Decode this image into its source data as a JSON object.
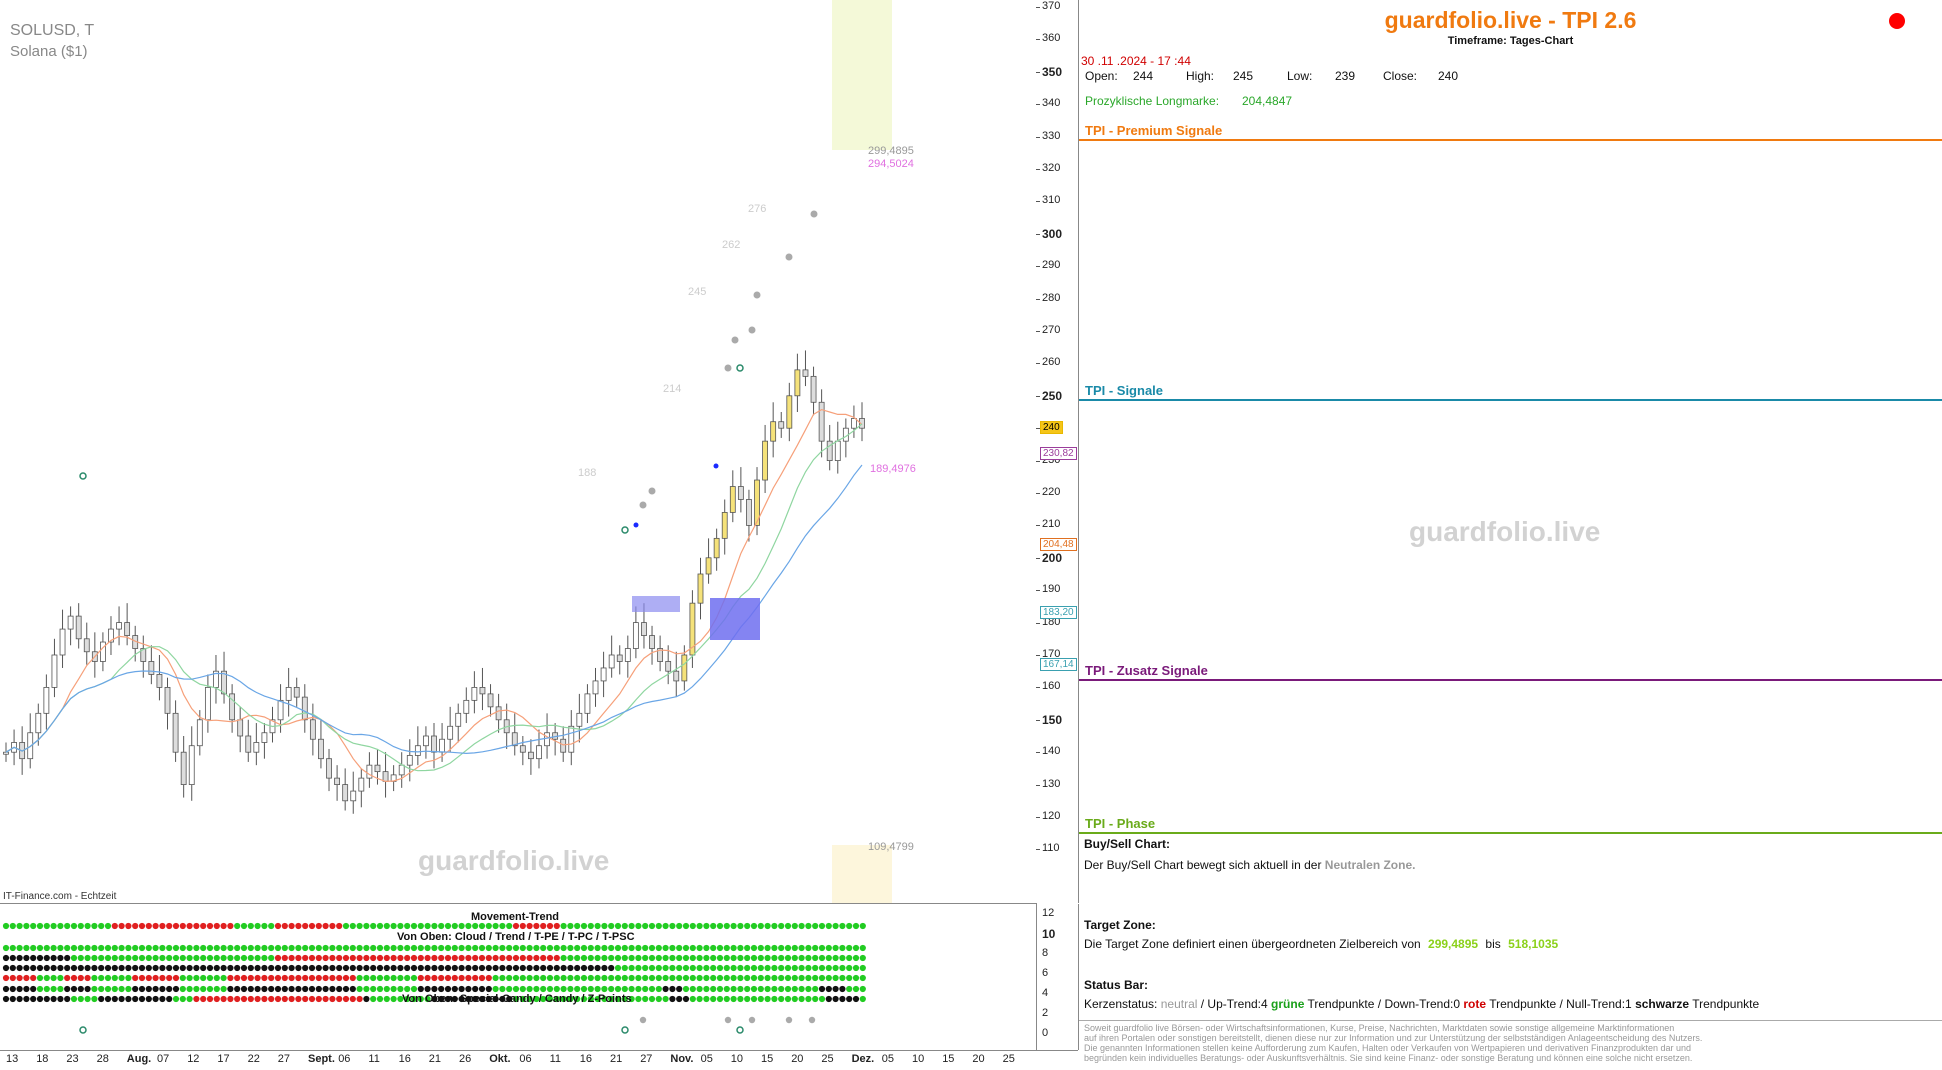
{
  "instrument": {
    "symbol": "SOLUSD, T",
    "name": "Solana ($1)"
  },
  "source_label": "IT-Finance.com - Echtzeit",
  "watermark": "guardfolio.live",
  "chart_data": {
    "type": "candlestick",
    "ylim": [
      100,
      370
    ],
    "y_ticks": [
      110,
      120,
      130,
      140,
      150,
      160,
      170,
      180,
      190,
      200,
      210,
      220,
      230,
      240,
      250,
      260,
      270,
      280,
      290,
      300,
      310,
      320,
      330,
      340,
      350,
      360,
      370
    ],
    "y_ticks_bold": [
      150,
      200,
      250,
      300,
      350
    ],
    "x_ticks": [
      "13",
      "18",
      "23",
      "28",
      "Aug.",
      "07",
      "12",
      "17",
      "22",
      "27",
      "Sept.",
      "06",
      "11",
      "16",
      "21",
      "26",
      "Okt.",
      "06",
      "11",
      "16",
      "21",
      "27",
      "Nov.",
      "05",
      "10",
      "15",
      "20",
      "25",
      "Dez.",
      "05",
      "10",
      "15",
      "20",
      "25"
    ],
    "x_ticks_bold": [
      "Aug.",
      "Sept.",
      "Okt.",
      "Nov.",
      "Dez."
    ],
    "price_tags": [
      {
        "value": "240",
        "price": 240,
        "color": "#e8b800",
        "fill": "#f5c518"
      },
      {
        "value": "230,82",
        "price": 232,
        "color": "#9b3d9b"
      },
      {
        "value": "204,48",
        "price": 204,
        "color": "#e07020"
      },
      {
        "value": "183,20",
        "price": 183,
        "color": "#3aa0b0"
      },
      {
        "value": "167,14",
        "price": 167,
        "color": "#3aa0b0"
      }
    ],
    "annotations": [
      {
        "text": "299,4895",
        "color": "#999999"
      },
      {
        "text": "294,5024",
        "color": "#e070e0"
      },
      {
        "text": "189,4976",
        "color": "#e070e0"
      },
      {
        "text": "109,4799",
        "color": "#999999"
      },
      {
        "text": "276",
        "color": "#cccccc"
      },
      {
        "text": "262",
        "color": "#cccccc"
      },
      {
        "text": "245",
        "color": "#cccccc"
      },
      {
        "text": "214",
        "color": "#cccccc"
      },
      {
        "text": "188",
        "color": "#cccccc"
      }
    ],
    "series": [
      {
        "name": "",
        "ohlc_close": [
          140,
          143,
          138,
          146,
          152,
          160,
          170,
          178,
          182,
          175,
          171,
          168,
          174,
          178,
          180,
          176,
          172,
          168,
          164,
          160,
          152,
          140,
          130,
          142,
          150,
          160,
          165,
          158,
          150,
          145,
          140,
          143,
          146,
          150,
          156,
          160,
          157,
          150,
          144,
          138,
          132,
          130,
          125,
          128,
          132,
          136,
          134,
          131,
          133,
          136,
          139,
          142,
          145,
          140,
          144,
          148,
          152,
          156,
          160,
          158,
          154,
          150,
          146,
          142,
          140,
          138,
          142,
          146,
          144,
          140,
          148,
          152,
          158,
          162,
          166,
          170,
          168,
          172,
          180,
          176,
          172,
          168,
          165,
          162,
          170,
          186,
          195,
          200,
          206,
          214,
          222,
          218,
          210,
          224,
          236,
          242,
          240,
          250,
          258,
          256,
          248,
          236,
          230,
          236,
          240,
          243,
          240
        ]
      }
    ]
  },
  "indicator": {
    "title1": "Movement-Trend",
    "title2": "Von Oben: Cloud / Trend / T-PE / T-PC / T-PSC",
    "title3": "Von Oben: Special-Candy / Candy / Z-Points",
    "y_ticks": [
      "12",
      "10",
      "8",
      "6",
      "4",
      "2",
      "0"
    ]
  },
  "header": {
    "title": "guardfolio.live - TPI 2.6",
    "timeframe": "Timeframe: Tages-Chart",
    "status_color": "#ff0000"
  },
  "quote": {
    "datetime": "30 .11 .2024  - 17 :44",
    "open_label": "Open:",
    "open": "244",
    "high_label": "High:",
    "high": "245",
    "low_label": "Low:",
    "low": "239",
    "close_label": "Close:",
    "close": "240",
    "long_label": "Prozyklische Longmarke:",
    "long_value": "204,4847"
  },
  "sections": {
    "premium": "TPI - Premium Signale",
    "signale": "TPI - Signale",
    "zusatz": "TPI - Zusatz Signale",
    "phase": "TPI - Phase"
  },
  "buysell": {
    "title": "Buy/Sell Chart:",
    "text": "Der Buy/Sell Chart bewegt sich aktuell in der",
    "zone": "Neutralen Zone."
  },
  "target": {
    "title": "Target Zone:",
    "text": "Die Target Zone definiert einen übergeordneten Zielbereich von",
    "from": "299,4895",
    "mid": "bis",
    "to": "518,1035"
  },
  "statusbar": {
    "title": "Status Bar:",
    "k1": "Kerzenstatus:",
    "v1": "neutral",
    "k2": "/ Up-Trend:4",
    "v2": "grüne",
    "k3": "Trendpunkte",
    "k4": "/ Down-Trend:0",
    "v4": "rote",
    "k5": "Trendpunkte",
    "k6": "/ Null-Trend:1",
    "v6": "schwarze",
    "k7": "Trendpunkte"
  },
  "disclaimer": [
    "Soweit guardfolio live Börsen- oder Wirtschaftsinformationen, Kurse, Preise, Nachrichten, Marktdaten sowie sonstige allgemeine Marktinformationen",
    "auf ihren Portalen oder sonstigen bereitstellt, dienen diese nur zur Information und zur Unterstützung der selbstständigen Anlageentscheidung des Nutzers.",
    "Die genannten Informationen stellen keine Aufforderung zum Kaufen, Halten oder Verkaufen von Wertpapieren und derivativen Finanzprodukten dar und",
    "begründen kein individuelles Beratungs- oder Auskunftsverhältnis. Sie sind keine Finanz- oder sonstige Beratung und können eine solche nicht ersetzen."
  ]
}
